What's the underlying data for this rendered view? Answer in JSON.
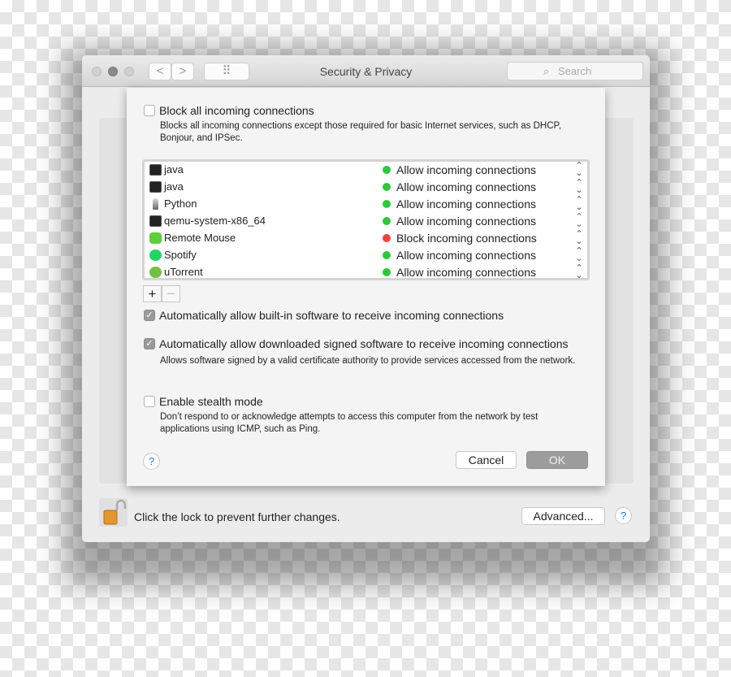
{
  "window": {
    "title": "Security & Privacy",
    "search_placeholder": "Search",
    "back": "<",
    "forward": ">",
    "grid": "⠿"
  },
  "sheet": {
    "block_all": {
      "label": "Block all incoming connections",
      "checked": false,
      "description": "Blocks all incoming connections except those required for basic Internet services, such as DHCP, Bonjour, and IPSec."
    },
    "apps": [
      {
        "name": "java",
        "icon": "terminal-icon",
        "status": "Allow incoming connections",
        "status_color": "#2dc83a"
      },
      {
        "name": "java",
        "icon": "terminal-icon",
        "status": "Allow incoming connections",
        "status_color": "#2dc83a"
      },
      {
        "name": "Python",
        "icon": "python-rocket-icon",
        "status": "Allow incoming connections",
        "status_color": "#2dc83a"
      },
      {
        "name": "qemu-system-x86_64",
        "icon": "terminal-icon",
        "status": "Allow incoming connections",
        "status_color": "#2dc83a"
      },
      {
        "name": "Remote Mouse",
        "icon": "remote-mouse-icon",
        "status": "Block incoming connections",
        "status_color": "#f0443a"
      },
      {
        "name": "Spotify",
        "icon": "spotify-icon",
        "status": "Allow incoming connections",
        "status_color": "#2dc83a"
      },
      {
        "name": "uTorrent",
        "icon": "utorrent-icon",
        "status": "Allow incoming connections",
        "status_color": "#2dc83a"
      }
    ],
    "add": "+",
    "remove": "−",
    "auto_builtin": {
      "label": "Automatically allow built-in software to receive incoming connections",
      "checked": true
    },
    "auto_signed": {
      "label": "Automatically allow downloaded signed software to receive incoming connections",
      "checked": true,
      "description": "Allows software signed by a valid certificate authority to provide services accessed from the network."
    },
    "stealth": {
      "label": "Enable stealth mode",
      "checked": false,
      "description": "Don’t respond to or acknowledge attempts to access this computer from the network by test applications using ICMP, such as Ping."
    },
    "help": "?",
    "cancel": "Cancel",
    "ok": "OK"
  },
  "footer": {
    "lock_text": "Click the lock to prevent further changes.",
    "advanced": "Advanced...",
    "help": "?"
  }
}
